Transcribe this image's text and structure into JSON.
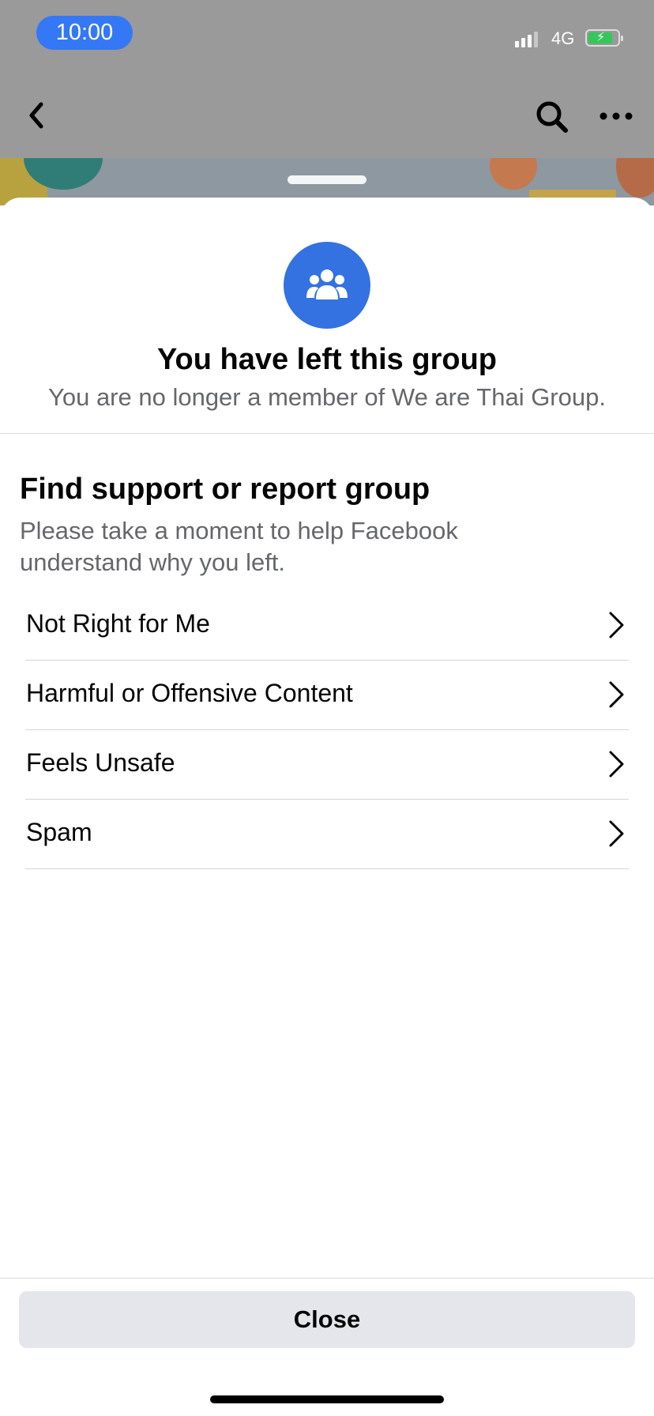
{
  "status_bar": {
    "time": "10:00",
    "network": "4G",
    "time_pill_color": "#3478f6",
    "battery_color": "#34c759"
  },
  "nav": {
    "back_icon": "chevron-left-icon",
    "search_icon": "search-icon",
    "more_icon": "more-horizontal-icon"
  },
  "sheet": {
    "icon": "group-people-icon",
    "icon_color": "#3372e0",
    "title": "You have left this group",
    "subtitle": "You are no longer a member of We are Thai Group.",
    "support": {
      "title": "Find support or report group",
      "description": "Please take a moment to help Facebook understand why you left."
    },
    "options": [
      {
        "label": "Not Right for Me"
      },
      {
        "label": "Harmful or Offensive Content"
      },
      {
        "label": "Feels Unsafe"
      },
      {
        "label": "Spam"
      }
    ],
    "close_label": "Close"
  }
}
